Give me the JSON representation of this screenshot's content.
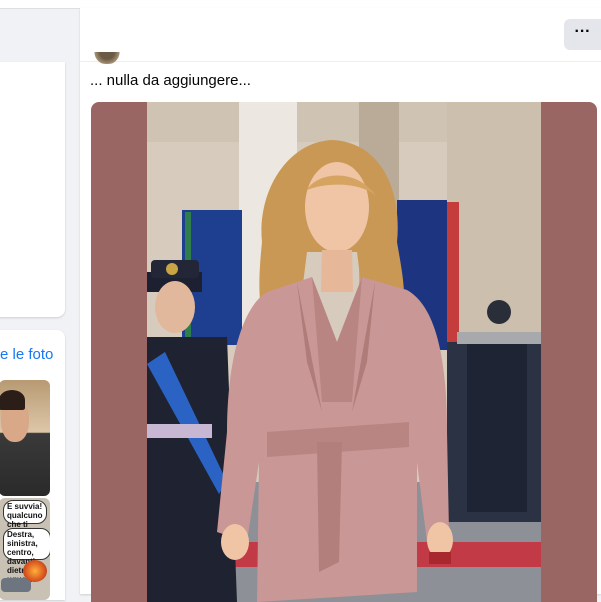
{
  "post": {
    "text": "... nulla da aggiungere...",
    "more_label": "···"
  },
  "sidebar": {
    "see_photos_link": "e le foto",
    "meme_bubble_1": "E suvvia! qualcuno che ti prende?",
    "meme_bubble_2": "Destra, sinistra, centro, davanti, dietro... È uguale!"
  },
  "colors": {
    "photo_border": "#9a6663",
    "link": "#1877f2",
    "suit": "#c99795"
  }
}
